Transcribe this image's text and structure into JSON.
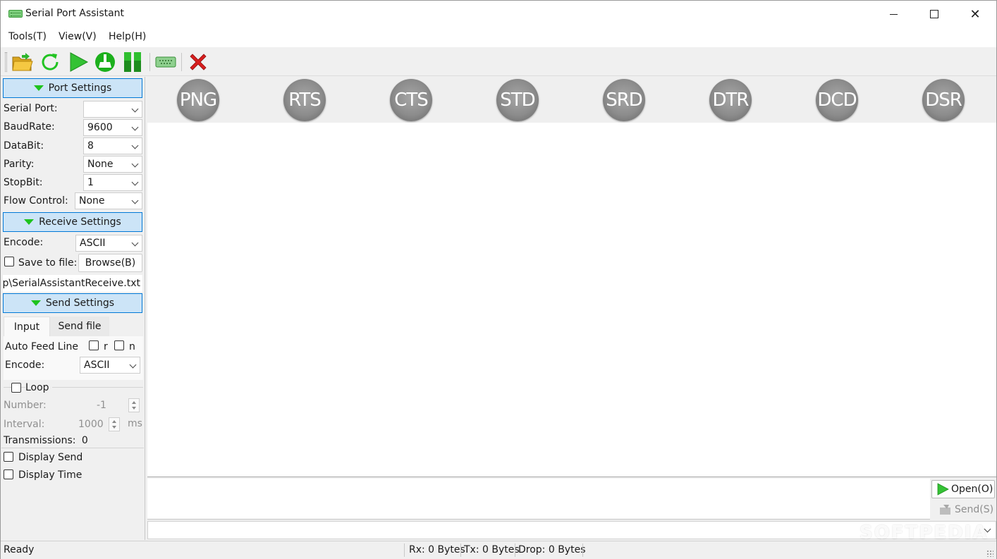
{
  "window": {
    "title": "Serial Port Assistant",
    "controls": {
      "minimize": "minimize",
      "maximize": "maximize",
      "close": "✕"
    }
  },
  "menu": [
    "Tools(T)",
    "View(V)",
    "Help(H)"
  ],
  "toolbar": {
    "icons": [
      "folder-open-icon",
      "refresh-icon",
      "play-icon",
      "clean-icon",
      "pause-icon",
      "serial-port-icon",
      "stop-icon"
    ]
  },
  "port_settings": {
    "header": "Port Settings",
    "serial_port_label": "Serial Port:",
    "serial_port_value": "",
    "baud_label": "BaudRate:",
    "baud_value": "9600",
    "databit_label": "DataBit:",
    "databit_value": "8",
    "parity_label": "Parity:",
    "parity_value": "None",
    "stopbit_label": "StopBit:",
    "stopbit_value": "1",
    "flow_label": "Flow Control:",
    "flow_value": "None"
  },
  "receive_settings": {
    "header": "Receive Settings",
    "encode_label": "Encode:",
    "encode_value": "ASCII",
    "save_label": "Save to file:",
    "browse_label": "Browse(B)",
    "file_path": "mp\\SerialAssistantReceive.txt"
  },
  "send_settings": {
    "header": "Send Settings",
    "tabs": [
      "Input",
      "Send file"
    ],
    "auto_feed_label": "Auto Feed Line",
    "r_label": "r",
    "n_label": "n",
    "encode_label": "Encode:",
    "encode_value": "ASCII",
    "loop_label": "Loop",
    "number_label": "Number:",
    "number_value": "-1",
    "interval_label": "Interval:",
    "interval_value": "1000",
    "interval_unit": "ms",
    "transmissions_label": "Transmissions:",
    "transmissions_value": "0"
  },
  "display": {
    "send_label": "Display Send",
    "time_label": "Display Time"
  },
  "indicators": [
    "PNG",
    "RTS",
    "CTS",
    "STD",
    "SRD",
    "DTR",
    "DCD",
    "DSR"
  ],
  "actions": {
    "open_label": "Open(O)",
    "send_label": "Send(S)"
  },
  "status": {
    "state": "Ready",
    "rx": "Rx: 0 Bytes",
    "tx": "Tx: 0 Bytes",
    "drop": "Drop: 0 Bytes"
  },
  "watermark": "SOFTPEDIA",
  "colors": {
    "header_bg": "#cce4f7",
    "header_border": "#0078d7",
    "accent_green": "#1ec31e",
    "stop_red": "#d81e1e",
    "led_gray": "#8c8c8c"
  }
}
